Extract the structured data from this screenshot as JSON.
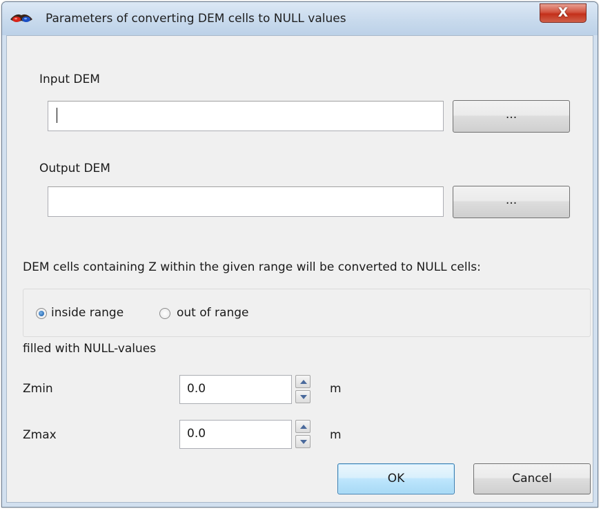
{
  "window": {
    "title": "Parameters of converting DEM cells to NULL values",
    "close_glyph": "X"
  },
  "input_dem": {
    "label": "Input DEM",
    "value": "",
    "browse_label": "..."
  },
  "output_dem": {
    "label": "Output DEM",
    "value": "",
    "browse_label": "..."
  },
  "range": {
    "description": "DEM cells containing Z within the given range will be converted to NULL cells:",
    "options": [
      {
        "label": "inside range",
        "selected": true
      },
      {
        "label": "out of range",
        "selected": false
      }
    ],
    "note": "filled with NULL-values"
  },
  "zmin": {
    "label": "Zmin",
    "value": "0.0",
    "unit": "m"
  },
  "zmax": {
    "label": "Zmax",
    "value": "0.0",
    "unit": "m"
  },
  "buttons": {
    "ok": "OK",
    "cancel": "Cancel"
  },
  "icons": {
    "app": "stereo-glasses-icon",
    "close": "close-icon",
    "spin_up": "arrow-up-icon",
    "spin_down": "arrow-down-icon"
  },
  "colors": {
    "title_bar": "#c7d9ec",
    "close_button": "#c3301a",
    "dialog_bg": "#f0f0f0",
    "default_button": "#bee6fd"
  }
}
